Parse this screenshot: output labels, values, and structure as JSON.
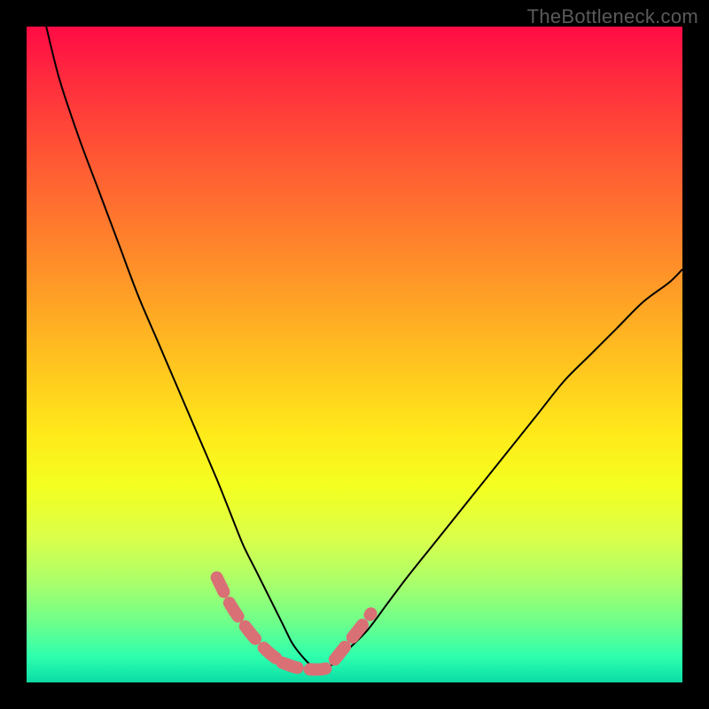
{
  "watermark": "TheBottleneck.com",
  "chart_data": {
    "type": "line",
    "title": "",
    "xlabel": "",
    "ylabel": "",
    "xlim": [
      0,
      100
    ],
    "ylim": [
      0,
      100
    ],
    "series": [
      {
        "name": "bottleneck-curve",
        "x": [
          3,
          5,
          8,
          11,
          14,
          17,
          20,
          23,
          26,
          29,
          31,
          33,
          35,
          37,
          39,
          40.5,
          42,
          43.5,
          45,
          47,
          49,
          52,
          55,
          58,
          62,
          66,
          70,
          74,
          78,
          82,
          86,
          90,
          94,
          98,
          100
        ],
        "y": [
          100,
          92,
          83,
          75,
          67,
          59,
          52,
          45,
          38,
          31,
          26,
          21,
          17,
          13,
          9,
          6,
          4,
          2.5,
          2,
          3,
          5,
          8,
          12,
          16,
          21,
          26,
          31,
          36,
          41,
          46,
          50,
          54,
          58,
          61,
          63
        ]
      }
    ],
    "highlight_segments": [
      {
        "name": "left-highlight",
        "x": [
          29,
          31,
          33,
          35,
          37,
          39
        ],
        "y": [
          16,
          12,
          9,
          6.5,
          4.5,
          3
        ]
      },
      {
        "name": "bottom-highlight",
        "x": [
          39,
          41,
          43,
          45,
          47
        ],
        "y": [
          3,
          2.3,
          2,
          2,
          2.5
        ]
      },
      {
        "name": "right-highlight",
        "x": [
          47,
          49,
          51,
          52.5
        ],
        "y": [
          3.5,
          6,
          8.5,
          10.5
        ]
      }
    ],
    "highlight_color": "#d97076",
    "curve_color": "#000000"
  }
}
